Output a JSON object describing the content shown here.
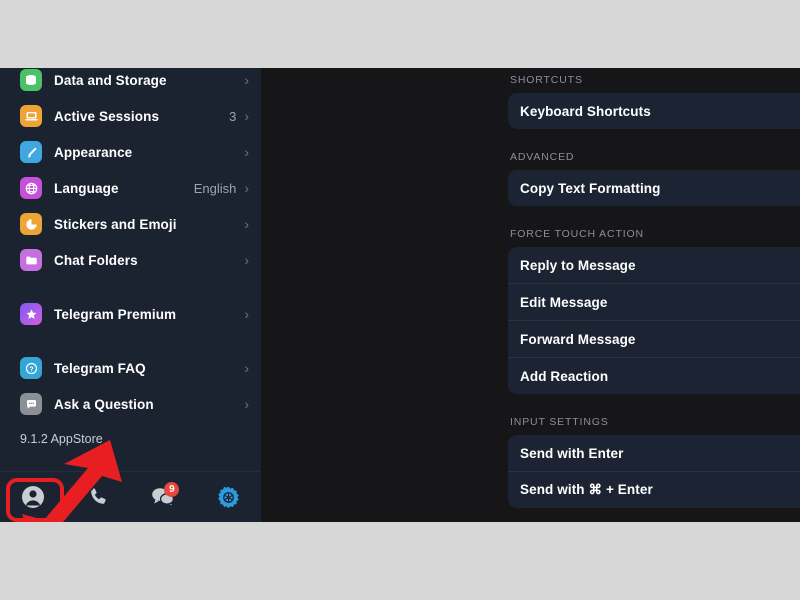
{
  "window": {
    "background_gray": "#d7d7d7",
    "app_background": "#171719",
    "sidebar_background": "#1b2230",
    "card_background": "#1c2433",
    "accent_blue": "#2f9ae0",
    "highlight_red": "#e81f22",
    "badge_red": "#e8473f"
  },
  "sidebar": {
    "items": [
      {
        "label": "Data and Storage",
        "value": "",
        "icon": "database-icon",
        "icon_color": "#4cc268",
        "chevron": "›"
      },
      {
        "label": "Active Sessions",
        "value": "3",
        "icon": "laptop-icon",
        "icon_color": "#eea336",
        "chevron": "›"
      },
      {
        "label": "Appearance",
        "value": "",
        "icon": "paintbrush-icon",
        "icon_color": "#40a8de",
        "chevron": "›"
      },
      {
        "label": "Language",
        "value": "English",
        "icon": "globe-icon",
        "icon_color": "#c551d8",
        "chevron": "›"
      },
      {
        "label": "Stickers and Emoji",
        "value": "",
        "icon": "sticker-icon",
        "icon_color": "#eea336",
        "chevron": "›"
      },
      {
        "label": "Chat Folders",
        "value": "",
        "icon": "folder-icon",
        "icon_color": "#c66fe0",
        "chevron": "›"
      },
      {
        "label": "Telegram Premium",
        "value": "",
        "icon": "premium-star-icon",
        "icon_color": "#a45cf0",
        "chevron": "›"
      },
      {
        "label": "Telegram FAQ",
        "value": "",
        "icon": "question-mark-icon",
        "icon_color": "#35a5d6",
        "chevron": "›"
      },
      {
        "label": "Ask a Question",
        "value": "",
        "icon": "chat-bubble-icon",
        "icon_color": "#8b8f96",
        "chevron": "›"
      }
    ],
    "version": "9.1.2      AppStore"
  },
  "tabbar": {
    "tabs": [
      {
        "name": "contacts-tab",
        "icon": "person-icon",
        "badge": ""
      },
      {
        "name": "calls-tab",
        "icon": "phone-icon",
        "badge": ""
      },
      {
        "name": "chats-tab",
        "icon": "chats-icon",
        "badge": "9"
      },
      {
        "name": "settings-tab",
        "icon": "gear-icon",
        "badge": ""
      }
    ]
  },
  "right_pane": {
    "sections": [
      {
        "title": "SHORTCUTS",
        "rows": [
          {
            "label": "Keyboard Shortcuts"
          }
        ]
      },
      {
        "title": "ADVANCED",
        "rows": [
          {
            "label": "Copy Text Formatting"
          }
        ]
      },
      {
        "title": "FORCE TOUCH ACTION",
        "rows": [
          {
            "label": "Reply to Message"
          },
          {
            "label": "Edit Message"
          },
          {
            "label": "Forward Message"
          },
          {
            "label": "Add Reaction"
          }
        ]
      },
      {
        "title": "INPUT SETTINGS",
        "rows": [
          {
            "label": "Send with Enter"
          },
          {
            "label": "Send with ⌘ + Enter"
          }
        ]
      }
    ]
  }
}
